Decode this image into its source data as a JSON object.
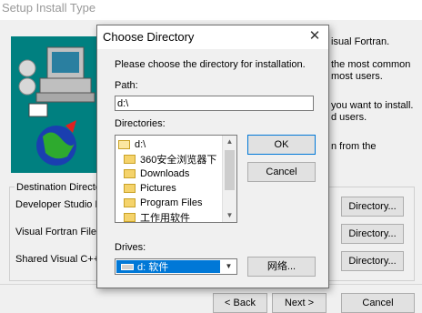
{
  "background": {
    "title": "Setup Install Type",
    "text_lines": [
      "isual Fortran.",
      "the most common",
      "most users.",
      "you want to install.",
      "d users.",
      "n from the"
    ],
    "group_legend": "Destination Directo",
    "rows": [
      {
        "label": "Developer Studio F",
        "button": "Directory..."
      },
      {
        "label": "Visual Fortran Files:",
        "button": "Directory..."
      },
      {
        "label": "Shared Visual C++",
        "button": "Directory..."
      }
    ],
    "back": "< Back",
    "next": "Next >",
    "cancel": "Cancel"
  },
  "dialog": {
    "title": "Choose Directory",
    "close_glyph": "✕",
    "instruction": "Please choose the directory for installation.",
    "path_label": "Path:",
    "path_value": "d:\\",
    "directories_label": "Directories:",
    "directories": [
      "d:\\",
      "360安全浏览器下",
      "Downloads",
      "Pictures",
      "Program Files",
      "工作用软件"
    ],
    "drives_label": "Drives:",
    "drive_selected": "d: 软件",
    "ok": "OK",
    "cancel": "Cancel",
    "network": "网络..."
  },
  "colors": {
    "selection": "#0078d7",
    "dialog_bg": "#f0f0f0",
    "art_bg": "#008080"
  }
}
